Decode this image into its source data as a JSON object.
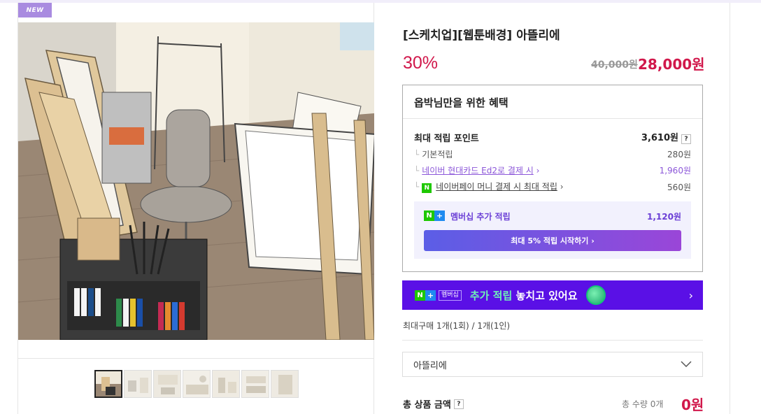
{
  "badge": "NEW",
  "product": {
    "title": "[스케치업][웹툰배경] 아뜰리에",
    "discount": "30%",
    "original_price": "40,000원",
    "sale_price": "28,000원"
  },
  "benefits": {
    "heading": "옵박님만을 위한 혜택",
    "max_points_label": "최대 적립 포인트",
    "max_points_value": "3,610원",
    "help": "?",
    "rows": [
      {
        "label": "기본적립",
        "value": "280원"
      },
      {
        "label": "네이버 현대카드 Ed2로 결제 시",
        "value": "1,960원"
      },
      {
        "label": "네이버페이 머니 결제 시 최대 적립",
        "value": "560원"
      }
    ],
    "npay_icon": "N",
    "tree_mark": "└",
    "chevron": "›",
    "membership": {
      "logo_n": "N",
      "logo_plus": "+",
      "label": "멤버십 추가 적립",
      "value": "1,120원",
      "button": "최대 5% 적립 시작하기 ›"
    }
  },
  "banner": {
    "badge_label": "멤버십",
    "text_highlight": "추가 적립",
    "text_rest": " 놓치고 있어요",
    "chevron": "›"
  },
  "max_purchase": "최대구매 1개(1회) / 1개(1인)",
  "option_select": {
    "value": "아뜰리에",
    "icon": "chevron-down-icon"
  },
  "total": {
    "label": "총 상품 금액",
    "help": "?",
    "quantity": "총 수량 0개",
    "price": "0원"
  },
  "colors": {
    "accent_red": "#d1184b",
    "purple": "#6b3fd6",
    "banner_bg": "#5a10e6",
    "npay_green": "#1ec800"
  }
}
